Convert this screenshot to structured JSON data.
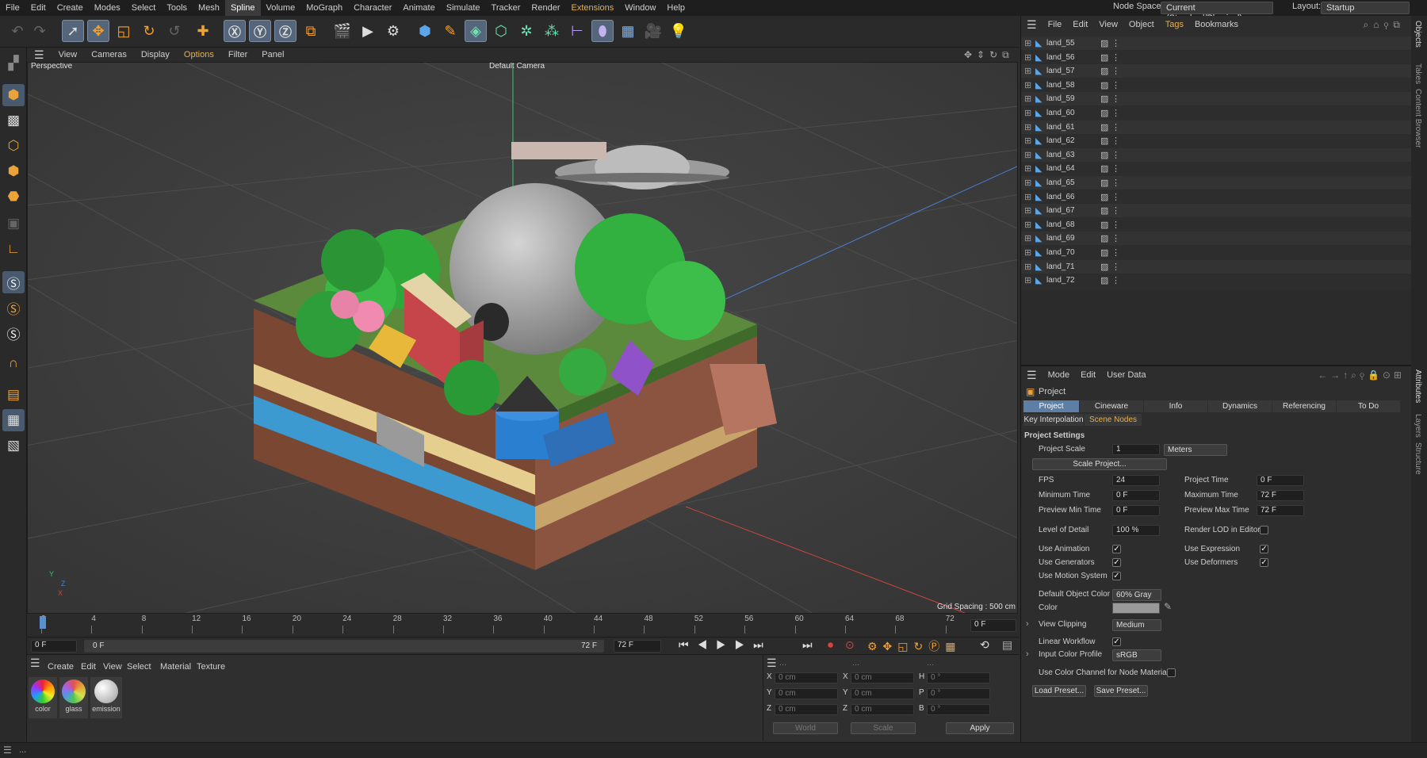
{
  "menu": {
    "items": [
      "File",
      "Edit",
      "Create",
      "Modes",
      "Select",
      "Tools",
      "Mesh",
      "Spline",
      "Volume",
      "MoGraph",
      "Character",
      "Animate",
      "Simulate",
      "Tracker",
      "Render",
      "Extensions",
      "Window",
      "Help"
    ],
    "node_space_label": "Node Space:",
    "node_space_value": "Current (Standard/Physical)",
    "layout_label": "Layout:",
    "layout_value": "Startup"
  },
  "viewport": {
    "menu": [
      "View",
      "Cameras",
      "Display",
      "Options",
      "Filter",
      "Panel"
    ],
    "name": "Perspective",
    "camera": "Default Camera",
    "grid_spacing": "Grid Spacing : 500 cm",
    "axis_y": "Y",
    "axis_z": "Z",
    "axis_x": "X"
  },
  "timeline": {
    "ticks": [
      "0",
      "4",
      "8",
      "12",
      "16",
      "20",
      "24",
      "28",
      "32",
      "36",
      "40",
      "44",
      "48",
      "52",
      "56",
      "60",
      "64",
      "68",
      "72"
    ],
    "current": "0 F"
  },
  "transport": {
    "start": "0 F",
    "range_start": "0 F",
    "range_end": "72 F",
    "end": "72 F"
  },
  "materials": {
    "menu": [
      "Create",
      "Edit",
      "View",
      "Select",
      "Material",
      "Texture"
    ],
    "items": [
      {
        "name": "color"
      },
      {
        "name": "glass"
      },
      {
        "name": "emission"
      }
    ]
  },
  "coords": {
    "x_pos": "0 cm",
    "y_pos": "0 cm",
    "z_pos": "0 cm",
    "x_size": "0 cm",
    "y_size": "0 cm",
    "z_size": "0 cm",
    "h": "0 °",
    "p": "0 °",
    "b": "0 °",
    "labels": [
      "X",
      "Y",
      "Z",
      "H",
      "P",
      "B"
    ],
    "col_heads": [
      "...",
      "...",
      "..."
    ],
    "world": "World",
    "scale": "Scale",
    "apply": "Apply"
  },
  "objects": {
    "menu": [
      "File",
      "Edit",
      "View",
      "Object",
      "Tags",
      "Bookmarks"
    ],
    "items": [
      "land_55",
      "land_56",
      "land_57",
      "land_58",
      "land_59",
      "land_60",
      "land_61",
      "land_62",
      "land_63",
      "land_64",
      "land_65",
      "land_66",
      "land_67",
      "land_68",
      "land_69",
      "land_70",
      "land_71",
      "land_72"
    ]
  },
  "attributes": {
    "menu": [
      "Mode",
      "Edit",
      "User Data"
    ],
    "title": "Project",
    "tabs": [
      "Project Settings",
      "Cineware",
      "Info",
      "Dynamics",
      "Referencing",
      "To Do"
    ],
    "tabs2": [
      "Key Interpolation",
      "Scene Nodes"
    ],
    "section": "Project Settings",
    "project_scale_label": "Project Scale",
    "project_scale": "1",
    "units": "Meters",
    "scale_project": "Scale Project...",
    "fps_label": "FPS",
    "fps": "24",
    "project_time_label": "Project Time",
    "project_time": "0 F",
    "min_time_label": "Minimum Time",
    "min_time": "0 F",
    "max_time_label": "Maximum Time",
    "max_time": "72 F",
    "prev_min_label": "Preview Min Time",
    "prev_min": "0 F",
    "prev_max_label": "Preview Max Time",
    "prev_max": "72 F",
    "lod_label": "Level of Detail",
    "lod": "100 %",
    "render_lod_label": "Render LOD in Editor",
    "use_anim": "Use Animation",
    "use_expr": "Use Expression",
    "use_gen": "Use Generators",
    "use_def": "Use Deformers",
    "use_motion": "Use Motion System",
    "def_color_label": "Default Object Color",
    "def_color": "60% Gray",
    "color_label": "Color",
    "view_clip_label": "View Clipping",
    "view_clip": "Medium",
    "linear_label": "Linear Workflow",
    "icp_label": "Input Color Profile",
    "icp": "sRGB",
    "use_color_channel": "Use Color Channel for Node Material",
    "load_preset": "Load Preset...",
    "save_preset": "Save Preset..."
  },
  "sidetabs": [
    "Objects",
    "Takes",
    "Content Browser",
    "Attributes",
    "Layers",
    "Structure"
  ],
  "status": "..."
}
